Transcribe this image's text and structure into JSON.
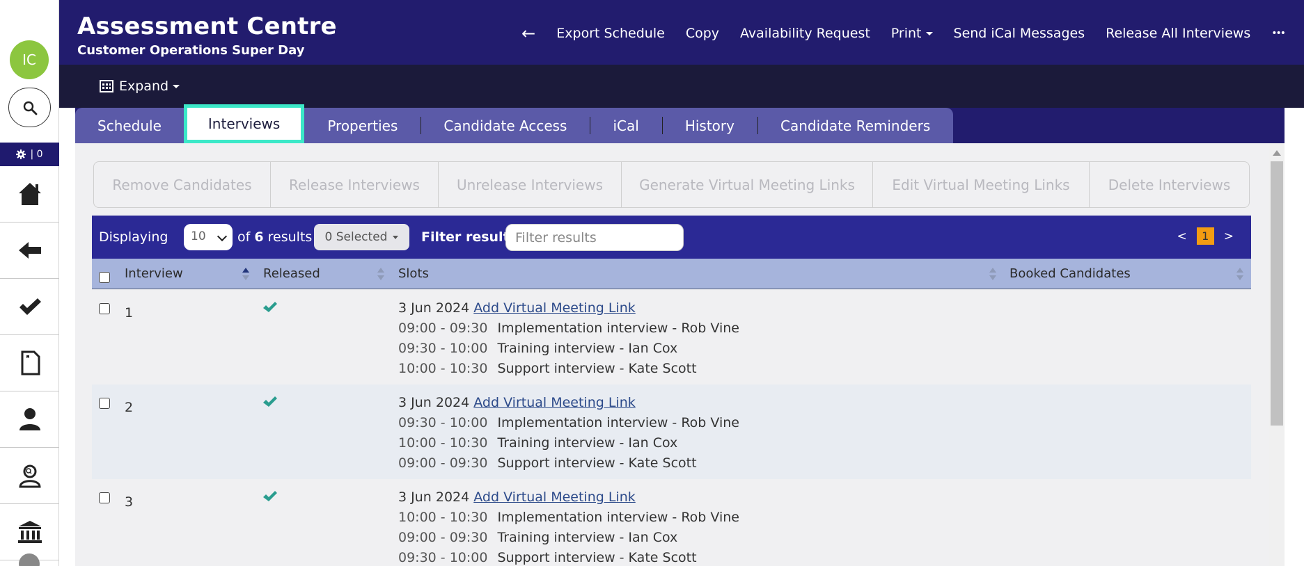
{
  "sidebar": {
    "avatar_initials": "IC",
    "gear_count": "| 0",
    "items": [
      {
        "icon": "home-icon"
      },
      {
        "icon": "back-arrow-icon"
      },
      {
        "icon": "checkmark-icon"
      },
      {
        "icon": "document-icon"
      },
      {
        "icon": "user-icon"
      },
      {
        "icon": "user-search-icon"
      },
      {
        "icon": "institution-icon"
      }
    ]
  },
  "header": {
    "title": "Assessment Centre",
    "subtitle": "Customer Operations Super Day",
    "back_label": "←",
    "actions": [
      "Export Schedule",
      "Copy",
      "Availability Request",
      "Print",
      "Send iCal Messages",
      "Release All Interviews"
    ],
    "more_label": "•••"
  },
  "subbar": {
    "expand_label": "Expand"
  },
  "tabs": [
    {
      "label": "Schedule",
      "active": false
    },
    {
      "label": "Interviews",
      "active": true
    },
    {
      "label": "Properties",
      "active": false
    },
    {
      "label": "Candidate Access",
      "active": false
    },
    {
      "label": "iCal",
      "active": false
    },
    {
      "label": "History",
      "active": false
    },
    {
      "label": "Candidate Reminders",
      "active": false
    }
  ],
  "action_buttons": [
    "Remove Candidates",
    "Release Interviews",
    "Unrelease Interviews",
    "Generate Virtual Meeting Links",
    "Edit Virtual Meeting Links",
    "Delete Interviews"
  ],
  "toolbar": {
    "displaying_label": "Displaying",
    "page_size": "10",
    "of_label": "of",
    "result_count": "6",
    "results_label": "results",
    "selected_label": "0 Selected",
    "filter_label": "Filter results",
    "filter_placeholder": "Filter results",
    "prev": "<",
    "current_page": "1",
    "next": ">"
  },
  "table": {
    "columns": [
      "Interview",
      "Released",
      "Slots",
      "Booked Candidates"
    ],
    "rows": [
      {
        "interview": "1",
        "date": "3 Jun 2024",
        "link_label": "Add Virtual Meeting Link",
        "slots": [
          {
            "time": "09:00 - 09:30",
            "desc": "Implementation interview - Rob Vine"
          },
          {
            "time": "09:30 - 10:00",
            "desc": "Training interview - Ian Cox"
          },
          {
            "time": "10:00 - 10:30",
            "desc": "Support interview - Kate Scott"
          }
        ]
      },
      {
        "interview": "2",
        "date": "3 Jun 2024",
        "link_label": "Add Virtual Meeting Link",
        "slots": [
          {
            "time": "09:30 - 10:00",
            "desc": "Implementation interview - Rob Vine"
          },
          {
            "time": "10:00 - 10:30",
            "desc": "Training interview - Ian Cox"
          },
          {
            "time": "09:00 - 09:30",
            "desc": "Support interview - Kate Scott"
          }
        ]
      },
      {
        "interview": "3",
        "date": "3 Jun 2024",
        "link_label": "Add Virtual Meeting Link",
        "slots": [
          {
            "time": "10:00 - 10:30",
            "desc": "Implementation interview - Rob Vine"
          },
          {
            "time": "09:00 - 09:30",
            "desc": "Training interview - Ian Cox"
          },
          {
            "time": "09:30 - 10:00",
            "desc": "Support interview - Kate Scott"
          }
        ]
      }
    ]
  },
  "colors": {
    "header": "#221c6e",
    "subbar": "#1b1a3a",
    "tab_active_border": "#3ce8c8",
    "avatar": "#8cc63f",
    "tick": "#2a9d8f"
  }
}
